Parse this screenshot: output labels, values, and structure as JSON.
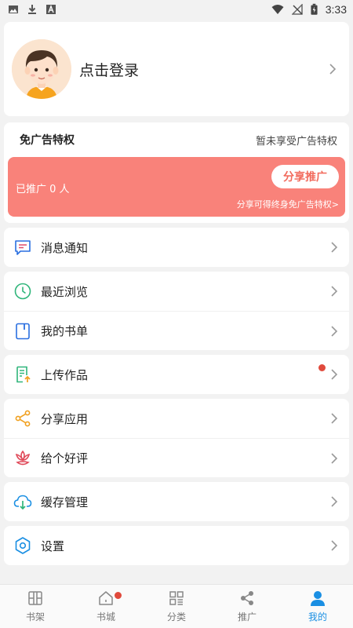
{
  "status_bar": {
    "time": "3:33",
    "left_icons": [
      "image-icon",
      "download-icon",
      "a-icon"
    ],
    "right_icons": [
      "wifi-icon",
      "no-signal-icon",
      "battery-icon"
    ]
  },
  "profile": {
    "login_label": "点击登录"
  },
  "ad_privilege": {
    "title": "免广告特权",
    "status": "暂未享受广告特权",
    "promoted_count": "已推广 0 人",
    "share_button": "分享推广",
    "share_hint": "分享可得终身免广告特权>"
  },
  "menu_groups": [
    [
      {
        "label": "消息通知",
        "icon": "message-icon"
      }
    ],
    [
      {
        "label": "最近浏览",
        "icon": "clock-icon"
      },
      {
        "label": "我的书单",
        "icon": "book-icon"
      }
    ],
    [
      {
        "label": "上传作品",
        "icon": "upload-doc-icon",
        "badge": true
      }
    ],
    [
      {
        "label": "分享应用",
        "icon": "share-icon"
      },
      {
        "label": "给个好评",
        "icon": "lotus-icon"
      }
    ],
    [
      {
        "label": "缓存管理",
        "icon": "cloud-download-icon"
      }
    ],
    [
      {
        "label": "设置",
        "icon": "settings-icon"
      }
    ]
  ],
  "bottom_nav": [
    {
      "label": "书架",
      "icon": "bookshelf-icon"
    },
    {
      "label": "书城",
      "icon": "home-icon",
      "badge": true
    },
    {
      "label": "分类",
      "icon": "grid-icon"
    },
    {
      "label": "推广",
      "icon": "share-nav-icon"
    },
    {
      "label": "我的",
      "icon": "user-icon",
      "active": true
    }
  ],
  "colors": {
    "promo_bg": "#f9827a",
    "accent_blue": "#1a8fe3",
    "badge_red": "#e04a3c"
  }
}
